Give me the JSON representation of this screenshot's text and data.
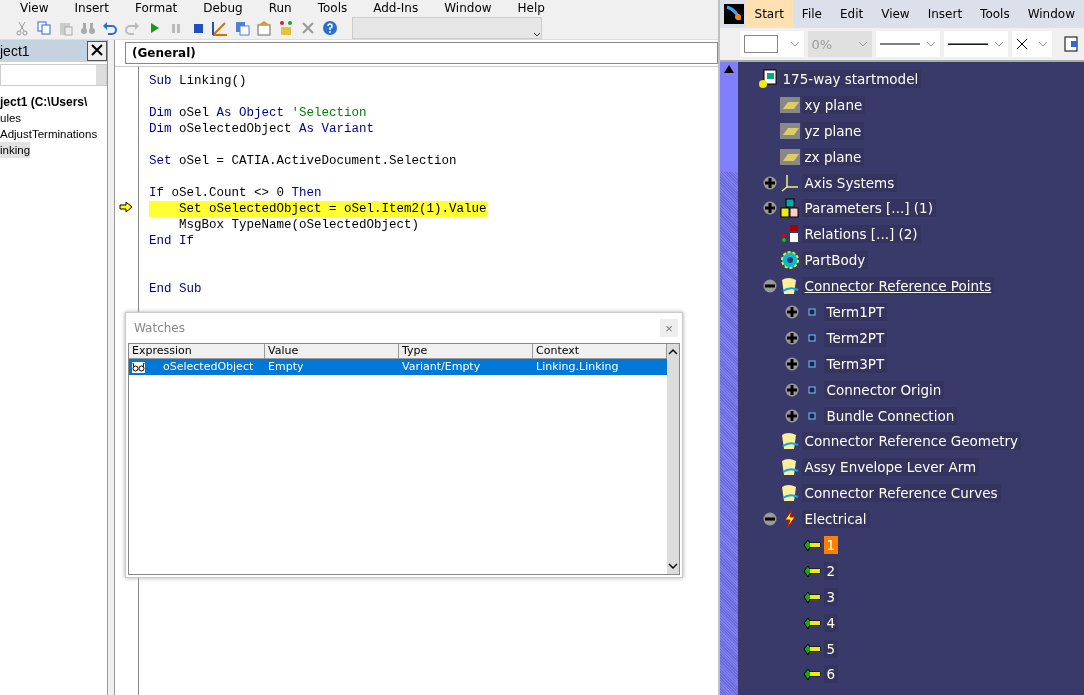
{
  "vba": {
    "menu": [
      "View",
      "Insert",
      "Format",
      "Debug",
      "Run",
      "Tools",
      "Add-Ins",
      "Window",
      "Help"
    ],
    "project": {
      "title": "ject1",
      "items": [
        {
          "label": "ject1 (C:\\Users\\",
          "kind": "root",
          "selected": false
        },
        {
          "label": "ules",
          "kind": "folder",
          "selected": false
        },
        {
          "label": "AdjustTerminations",
          "kind": "module",
          "selected": false
        },
        {
          "label": "inking",
          "kind": "module",
          "selected": true
        }
      ]
    },
    "code": {
      "object": "(General)",
      "lines": [
        {
          "current": false,
          "parts": [
            {
              "kind": "keyword",
              "text": "Sub "
            },
            {
              "kind": "plain",
              "text": "Linking()"
            }
          ]
        },
        {
          "current": false
        },
        {
          "current": false,
          "parts": [
            {
              "kind": "keyword",
              "text": "Dim "
            },
            {
              "kind": "plain",
              "text": "oSel "
            },
            {
              "kind": "keyword",
              "text": "As Object "
            },
            {
              "kind": "comment",
              "text": "'Selection"
            }
          ]
        },
        {
          "current": false,
          "parts": [
            {
              "kind": "keyword",
              "text": "Dim "
            },
            {
              "kind": "plain",
              "text": "oSelectedObject "
            },
            {
              "kind": "keyword",
              "text": "As Variant"
            }
          ]
        },
        {
          "current": false
        },
        {
          "current": false,
          "parts": [
            {
              "kind": "keyword",
              "text": "Set "
            },
            {
              "kind": "plain",
              "text": "oSel = CATIA.ActiveDocument.Selection"
            }
          ]
        },
        {
          "current": false
        },
        {
          "current": false,
          "parts": [
            {
              "kind": "keyword",
              "text": "If "
            },
            {
              "kind": "plain",
              "text": "oSel.Count <> 0 "
            },
            {
              "kind": "keyword",
              "text": "Then"
            }
          ]
        },
        {
          "current": true,
          "parts": [
            {
              "kind": "plain",
              "text": "    Set oSelectedObject = oSel.Item2(1).Value"
            }
          ]
        },
        {
          "current": false,
          "parts": [
            {
              "kind": "plain",
              "text": "    MsgBox TypeName(oSelectedObject)"
            }
          ]
        },
        {
          "current": false,
          "parts": [
            {
              "kind": "keyword",
              "text": "End If"
            }
          ]
        },
        {
          "current": false
        },
        {
          "current": false
        },
        {
          "current": false,
          "parts": [
            {
              "kind": "keyword",
              "text": "End Sub"
            }
          ]
        }
      ]
    },
    "watches": {
      "title": "Watches",
      "close": "×",
      "columns": [
        "Expression",
        "Value",
        "Type",
        "Context"
      ],
      "rows": [
        {
          "selected": true,
          "cells": [
            "oSelectedObject",
            "Empty",
            "Variant/Empty",
            "Linking.Linking"
          ]
        }
      ]
    }
  },
  "catia": {
    "menu": [
      {
        "label": "Start",
        "selected": true
      },
      {
        "label": "File",
        "selected": false
      },
      {
        "label": "Edit",
        "selected": false
      },
      {
        "label": "View",
        "selected": false
      },
      {
        "label": "Insert",
        "selected": false
      },
      {
        "label": "Tools",
        "selected": false
      },
      {
        "label": "Window",
        "selected": false
      }
    ],
    "toolbar": {
      "transparency": "0%"
    },
    "tree": [
      {
        "label": "175-way startmodel",
        "kind": "part",
        "selected": false,
        "children": [
          {
            "label": "xy plane",
            "kind": "plane",
            "selected": false
          },
          {
            "label": "yz plane",
            "kind": "plane",
            "selected": false
          },
          {
            "label": "zx plane",
            "kind": "plane",
            "selected": false
          },
          {
            "label": "Axis Systems",
            "kind": "axis",
            "selected": false,
            "expanded": false
          },
          {
            "label": "Parameters [...] (1)",
            "kind": "parameters",
            "selected": false,
            "expanded": false
          },
          {
            "label": "Relations [...] (2)",
            "kind": "relations",
            "selected": false
          },
          {
            "label": "PartBody",
            "kind": "body",
            "selected": false
          },
          {
            "label": "Connector Reference Points",
            "kind": "geoset",
            "selected": true,
            "expanded": true,
            "children": [
              {
                "label": "Term1PT",
                "kind": "point",
                "selected": false,
                "expanded": false
              },
              {
                "label": "Term2PT",
                "kind": "point",
                "selected": false,
                "expanded": false
              },
              {
                "label": "Term3PT",
                "kind": "point",
                "selected": false,
                "expanded": false
              },
              {
                "label": "Connector Origin",
                "kind": "point",
                "selected": false,
                "expanded": false
              },
              {
                "label": "Bundle Connection",
                "kind": "point",
                "selected": false,
                "expanded": false
              }
            ]
          },
          {
            "label": "Connector Reference Geometry",
            "kind": "geoset",
            "selected": false
          },
          {
            "label": "Assy Envelope Lever Arm",
            "kind": "geoset",
            "selected": false
          },
          {
            "label": "Connector Reference Curves",
            "kind": "geoset",
            "selected": false
          },
          {
            "label": "Electrical",
            "kind": "electrical",
            "selected": false,
            "expanded": true,
            "children": [
              {
                "label": "1",
                "kind": "pin",
                "selected": true
              },
              {
                "label": "2",
                "kind": "pin",
                "selected": false
              },
              {
                "label": "3",
                "kind": "pin",
                "selected": false
              },
              {
                "label": "4",
                "kind": "pin",
                "selected": false
              },
              {
                "label": "5",
                "kind": "pin",
                "selected": false
              },
              {
                "label": "6",
                "kind": "pin",
                "selected": false
              }
            ]
          }
        ]
      }
    ]
  }
}
